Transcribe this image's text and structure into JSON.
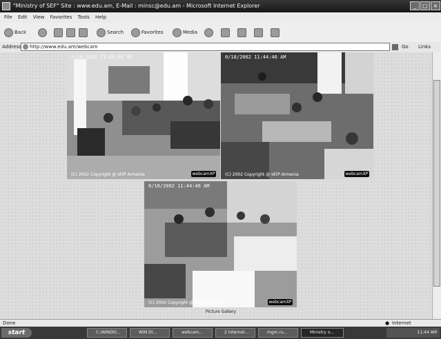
{
  "window": {
    "title": "\"Ministry of SEF\" Site : www.edu.am, E-Mail : minsc@edu.am - Microsoft Internet Explorer"
  },
  "menu": [
    "File",
    "Edit",
    "View",
    "Favorites",
    "Tools",
    "Help"
  ],
  "toolbar": {
    "back": "Back",
    "search": "Search",
    "favorites": "Favorites",
    "media": "Media"
  },
  "address": {
    "label": "Address",
    "url": "http://www.edu.am/webcam",
    "go": "Go",
    "links": "Links"
  },
  "cams": [
    {
      "timestamp": "0/18/2002 11:44:46 AM",
      "footer": "(C) 2002   Copyright @ IATP Armenia",
      "logo": "webcamXP"
    },
    {
      "timestamp": "0/18/2002 11:44:46 AM",
      "footer": "(C) 2002   Copyright @ IATP Armenia",
      "logo": "webcamXP"
    },
    {
      "timestamp": "0/18/2002 11:44:46 AM",
      "footer": "(C) 2002   Copyright @ IATP Armenia",
      "logo": "webcamXP"
    }
  ],
  "caption": "Picture Gallery",
  "status": {
    "left": "Done",
    "zone": "Internet"
  },
  "taskbar": {
    "start": "start",
    "buttons": [
      "C:\\WINDO...",
      "WIN DI...",
      "webcam...",
      "2 Internet...",
      "mgm.ru...",
      "Ministry o..."
    ],
    "clock": "11:44 AM"
  }
}
